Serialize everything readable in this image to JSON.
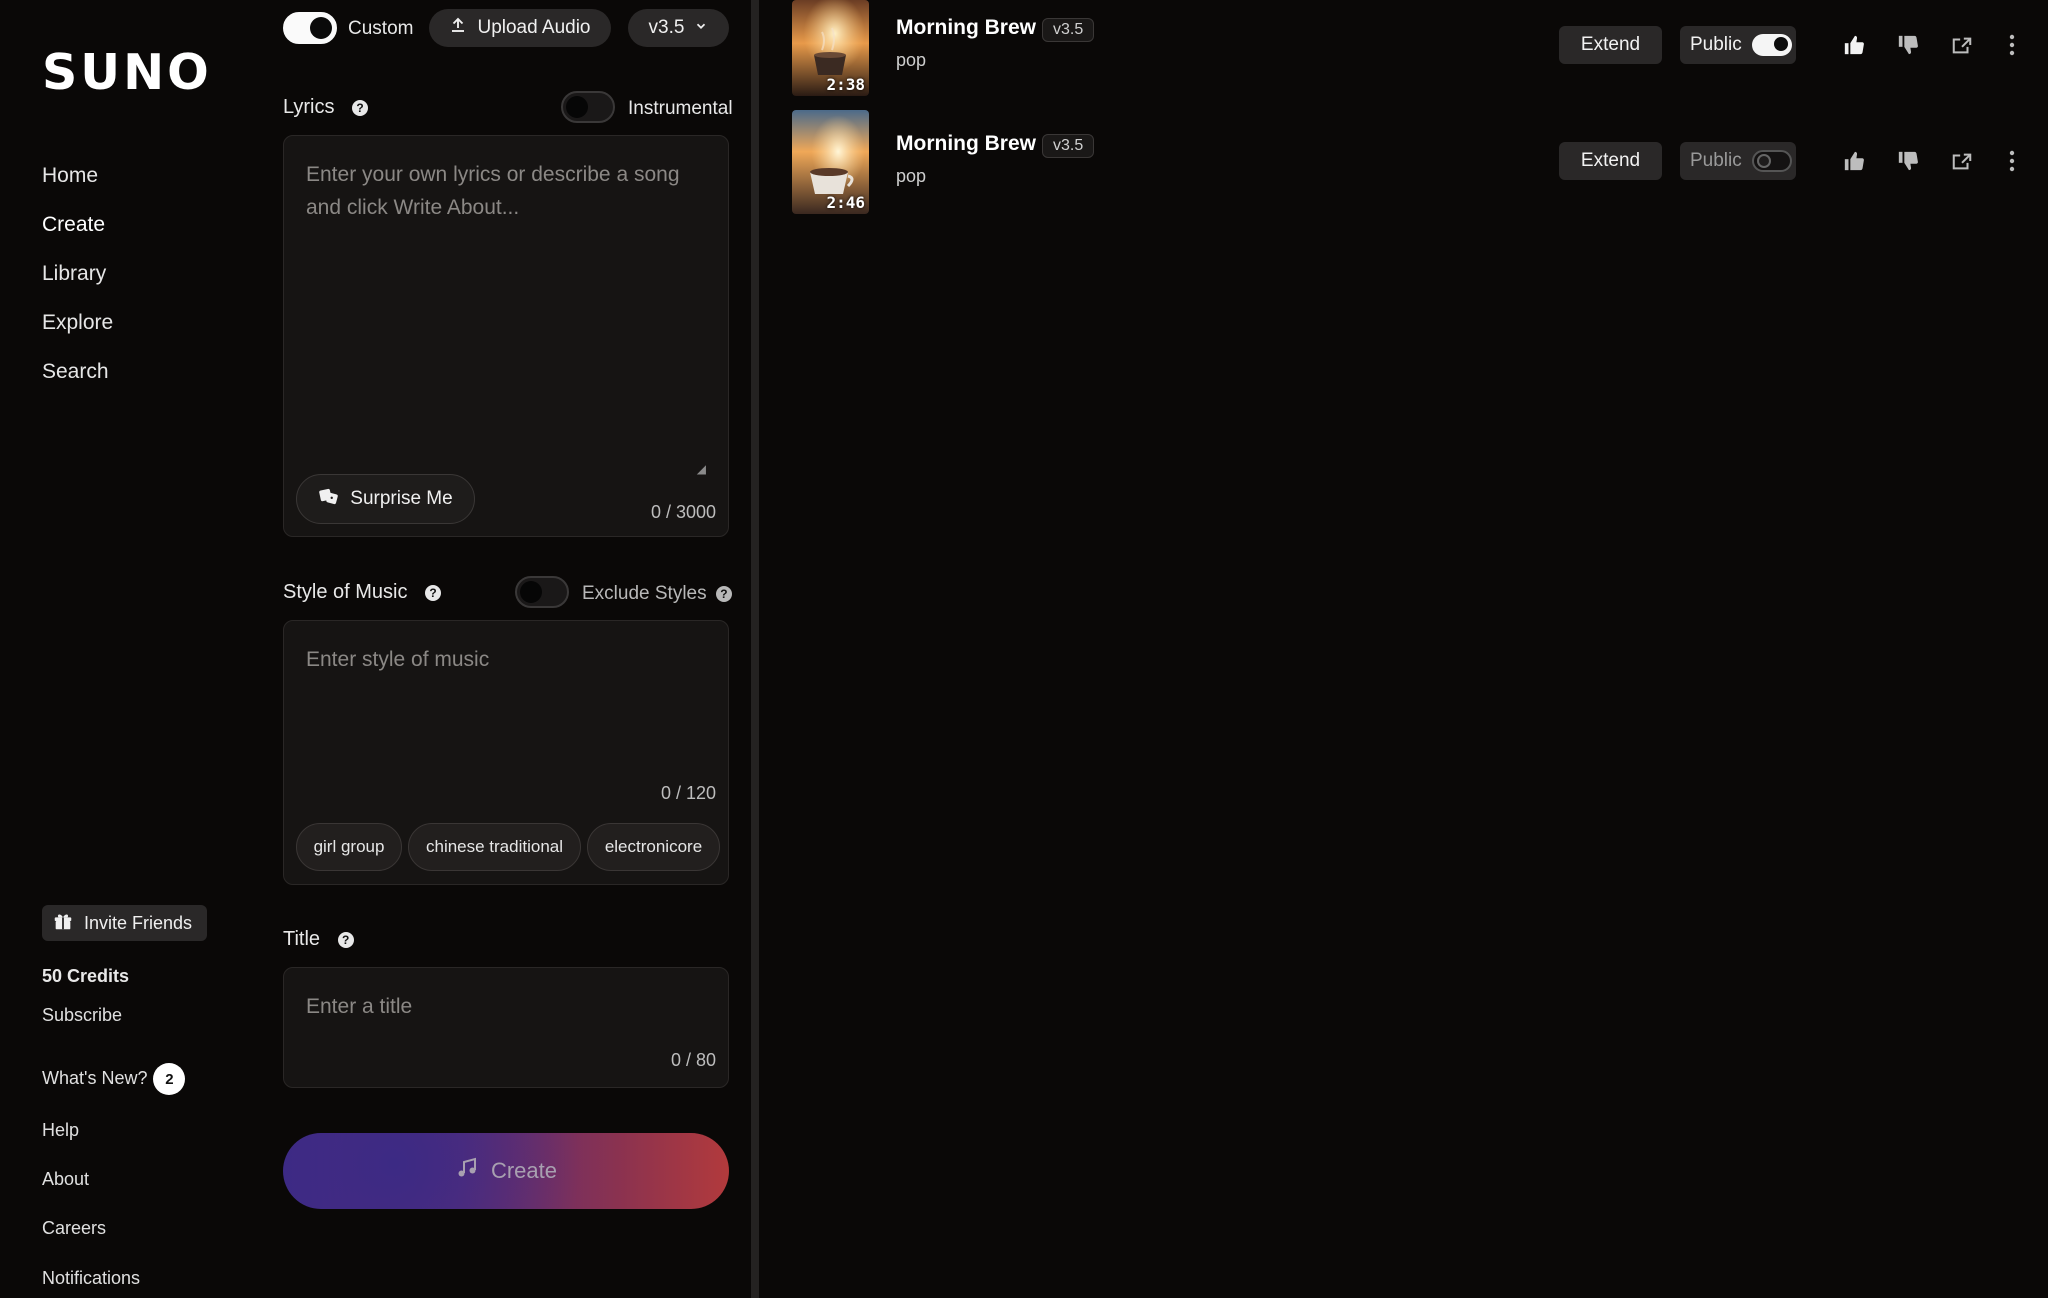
{
  "sidebar": {
    "logo": "SUNO",
    "nav": [
      {
        "label": "Home"
      },
      {
        "label": "Create"
      },
      {
        "label": "Library"
      },
      {
        "label": "Explore"
      },
      {
        "label": "Search"
      }
    ],
    "invite_label": "Invite Friends",
    "credits": "50 Credits",
    "subscribe": "Subscribe",
    "whats_new": "What's New?",
    "whats_new_count": "2",
    "help": "Help",
    "about": "About",
    "careers": "Careers",
    "notifications": "Notifications"
  },
  "create_panel": {
    "custom_label": "Custom",
    "upload_label": "Upload Audio",
    "version": "v3.5",
    "lyrics_label": "Lyrics",
    "instrumental_label": "Instrumental",
    "lyrics_placeholder": "Enter your own lyrics or describe a song and click Write About...",
    "surprise_label": "Surprise Me",
    "lyrics_counter": "0 / 3000",
    "style_label": "Style of Music",
    "exclude_label": "Exclude Styles",
    "style_placeholder": "Enter style of music",
    "style_counter": "0 / 120",
    "style_tags": [
      "girl group",
      "chinese traditional",
      "electronicore"
    ],
    "title_label": "Title",
    "title_placeholder": "Enter a title",
    "title_counter": "0 / 80",
    "create_label": "Create"
  },
  "songs": [
    {
      "title": "Morning Brew",
      "version": "v3.5",
      "genre": "pop",
      "duration": "2:38",
      "extend_label": "Extend",
      "public_label": "Public",
      "public": true
    },
    {
      "title": "Morning Brew",
      "version": "v3.5",
      "genre": "pop",
      "duration": "2:46",
      "extend_label": "Extend",
      "public_label": "Public",
      "public": false
    }
  ],
  "icons": {
    "like": "thumbs-up-icon",
    "dislike": "thumbs-down-icon",
    "share": "share-icon",
    "more": "more-vertical-icon"
  },
  "colors": {
    "background": "#0a0807",
    "panel": "#161413",
    "button": "#2a2828",
    "create_gradient_start": "#3d2a86",
    "create_gradient_end": "#b23a3c"
  }
}
